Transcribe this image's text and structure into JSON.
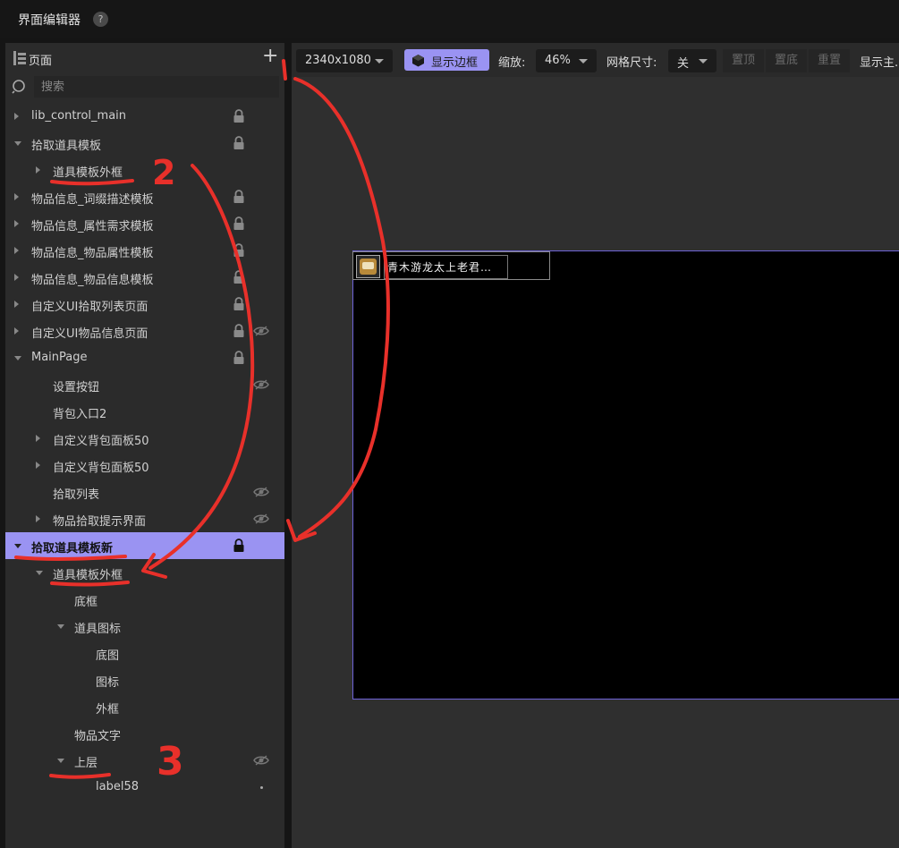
{
  "app": {
    "title": "界面编辑器",
    "help": "?"
  },
  "panel": {
    "header": "页面",
    "add": "+",
    "search_placeholder": "搜索"
  },
  "tree": [
    {
      "label": "lib_control_main"
    },
    {
      "label": "拾取道具模板"
    },
    {
      "label": "道具模板外框"
    },
    {
      "label": "物品信息_词缀描述模板"
    },
    {
      "label": "物品信息_属性需求模板"
    },
    {
      "label": "物品信息_物品属性模板"
    },
    {
      "label": "物品信息_物品信息模板"
    },
    {
      "label": "自定义UI拾取列表页面"
    },
    {
      "label": "自定义UI物品信息页面"
    },
    {
      "label": "MainPage"
    },
    {
      "label": "设置按钮"
    },
    {
      "label": "背包入口2"
    },
    {
      "label": "自定义背包面板50"
    },
    {
      "label": "自定义背包面板50"
    },
    {
      "label": "拾取列表"
    },
    {
      "label": "物品拾取提示界面"
    },
    {
      "label": "拾取道具模板新"
    },
    {
      "label": "道具模板外框"
    },
    {
      "label": "底框"
    },
    {
      "label": "道具图标"
    },
    {
      "label": "底图"
    },
    {
      "label": "图标"
    },
    {
      "label": "外框"
    },
    {
      "label": "物品文字"
    },
    {
      "label": "上层"
    },
    {
      "label": "label58"
    }
  ],
  "toolbar": {
    "resolution": "2340x1080",
    "show_border": "显示边框",
    "zoom_label": "缩放:",
    "zoom_value": "46%",
    "grid_label": "网格尺寸:",
    "grid_value": "关",
    "top": "置顶",
    "bottom": "置底",
    "reset": "重置",
    "show_main": "显示主..."
  },
  "canvas": {
    "item_text": "青木游龙太上老君…"
  },
  "annotations": {
    "n1": "1",
    "n2": "2",
    "n3": "3"
  },
  "colors": {
    "accent": "#9a93f2",
    "annotation": "#e8302a",
    "artboard_border": "#6e63d8"
  }
}
